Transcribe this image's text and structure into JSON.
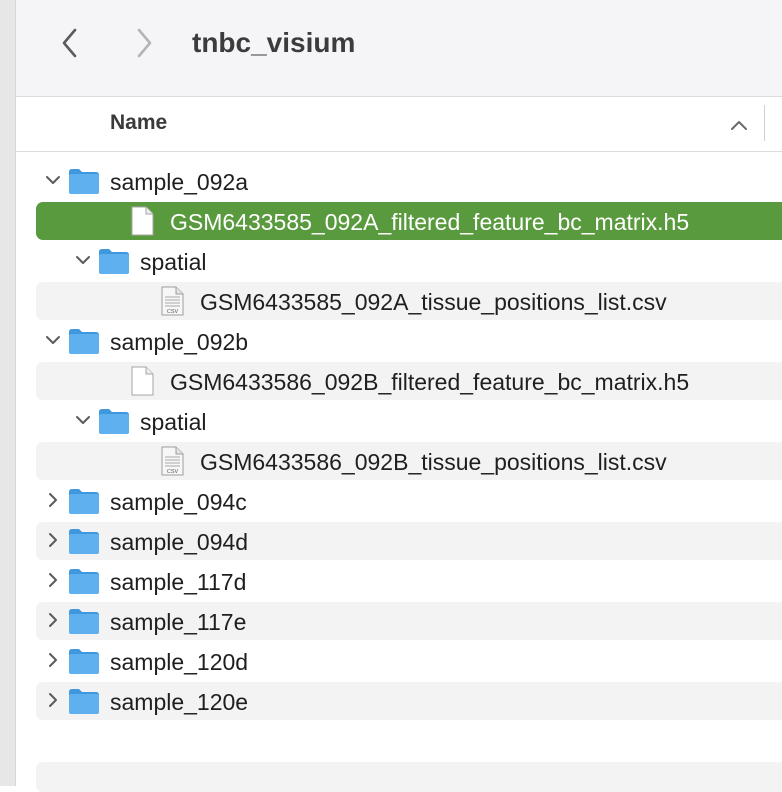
{
  "window": {
    "title": "tnbc_visium"
  },
  "toolbar": {
    "back_icon": "chevron-left-icon",
    "forward_icon": "chevron-right-icon"
  },
  "columns": {
    "name_label": "Name",
    "sort_icon": "chevron-up-icon"
  },
  "colors": {
    "selection": "#5a9a3e",
    "folder": "#5fb0ee",
    "alt_row": "#f3f3f3"
  },
  "files": [
    {
      "name": "sample_092a",
      "type": "folder",
      "expanded": true
    },
    {
      "name": "GSM6433585_092A_filtered_feature_bc_matrix.h5",
      "type": "file",
      "selected": true
    },
    {
      "name": "spatial",
      "type": "folder",
      "expanded": true
    },
    {
      "name": "GSM6433585_092A_tissue_positions_list.csv",
      "type": "csv",
      "badge": "CSV"
    },
    {
      "name": "sample_092b",
      "type": "folder",
      "expanded": true
    },
    {
      "name": "GSM6433586_092B_filtered_feature_bc_matrix.h5",
      "type": "file"
    },
    {
      "name": "spatial",
      "type": "folder",
      "expanded": true
    },
    {
      "name": "GSM6433586_092B_tissue_positions_list.csv",
      "type": "csv",
      "badge": "CSV"
    },
    {
      "name": "sample_094c",
      "type": "folder",
      "expanded": false
    },
    {
      "name": "sample_094d",
      "type": "folder",
      "expanded": false
    },
    {
      "name": "sample_117d",
      "type": "folder",
      "expanded": false
    },
    {
      "name": "sample_117e",
      "type": "folder",
      "expanded": false
    },
    {
      "name": "sample_120d",
      "type": "folder",
      "expanded": false
    },
    {
      "name": "sample_120e",
      "type": "folder",
      "expanded": false
    }
  ]
}
